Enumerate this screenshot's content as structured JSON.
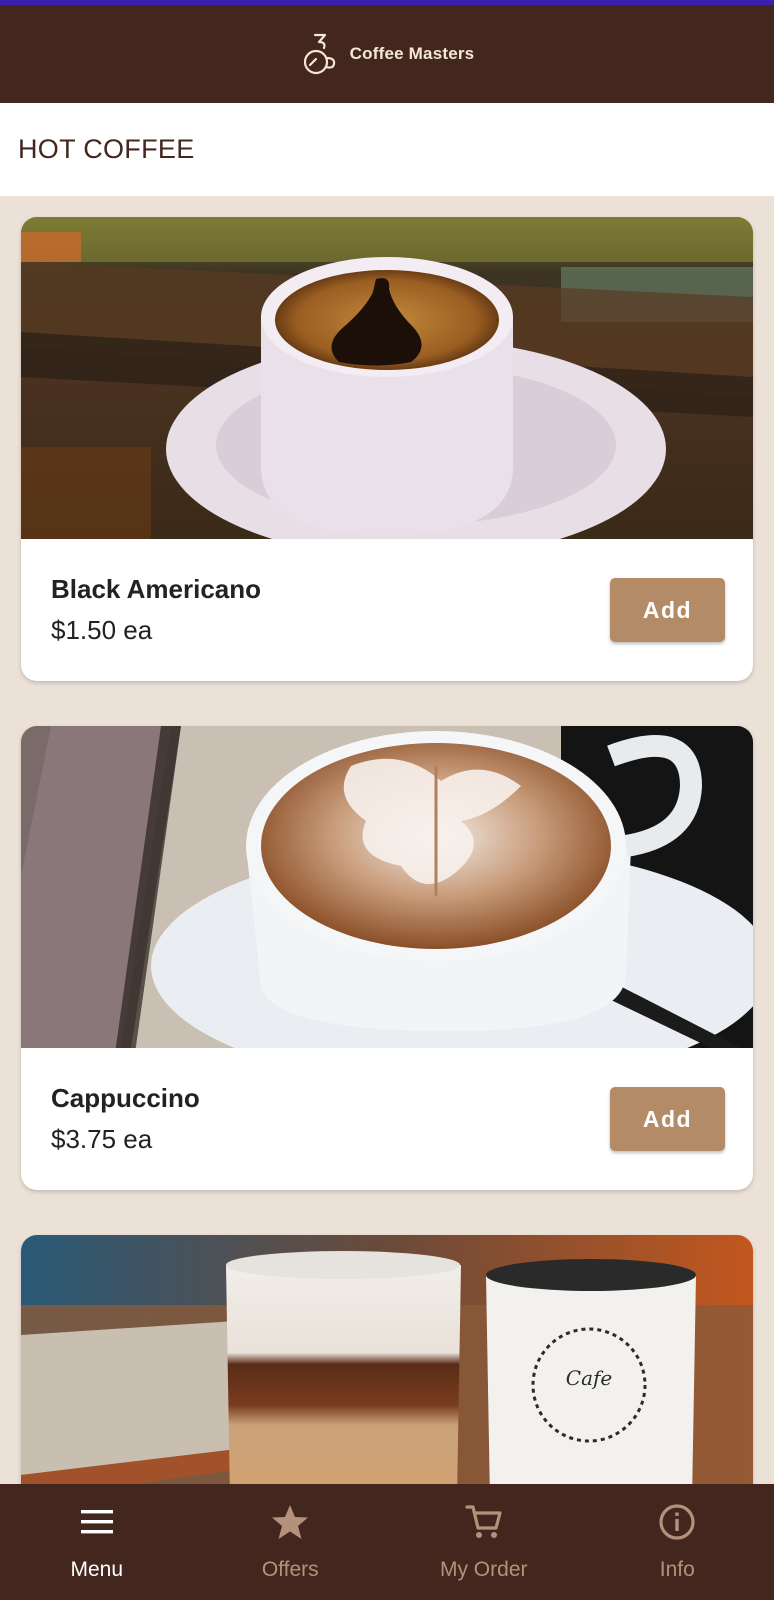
{
  "app": {
    "name": "Coffee Masters",
    "theme": {
      "primary": "#43271e",
      "accent": "#b48b67",
      "background": "#ece1d7"
    }
  },
  "section": {
    "title": "HOT COFFEE"
  },
  "products": [
    {
      "name": "Black Americano",
      "price": "$1.50 ea",
      "button": "Add",
      "image": "black-coffee-cup-on-saucer"
    },
    {
      "name": "Cappuccino",
      "price": "$3.75 ea",
      "button": "Add",
      "image": "latte-art-cappuccino-cup"
    },
    {
      "name": "",
      "price": "",
      "button": "",
      "image": "layered-latte-glass-and-enamel-mug"
    }
  ],
  "nav": {
    "active": "Menu",
    "items": [
      {
        "label": "Menu",
        "icon": "menu-icon"
      },
      {
        "label": "Offers",
        "icon": "star-icon"
      },
      {
        "label": "My Order",
        "icon": "cart-icon"
      },
      {
        "label": "Info",
        "icon": "info-icon"
      }
    ]
  }
}
